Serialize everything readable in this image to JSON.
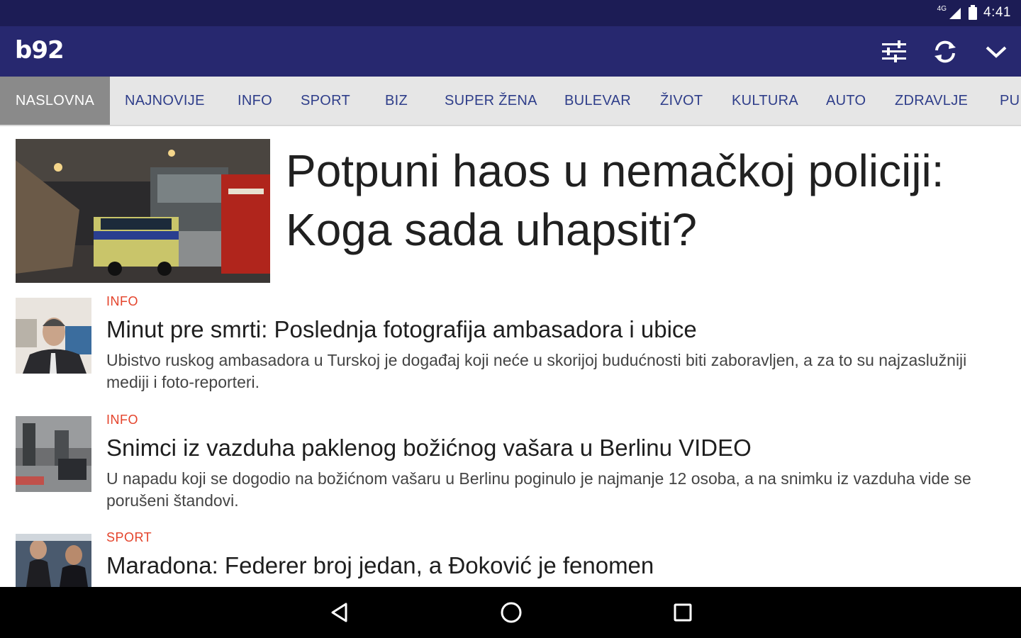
{
  "status_bar": {
    "network": "4G",
    "time": "4:41",
    "signal_icon": "signal-icon",
    "battery_icon": "battery-icon"
  },
  "app_bar": {
    "logo": "b92",
    "actions": [
      {
        "icon": "sliders-icon"
      },
      {
        "icon": "refresh-icon"
      },
      {
        "icon": "chevron-down-icon"
      }
    ]
  },
  "tabs": [
    {
      "label": "NASLOVNA",
      "active": true
    },
    {
      "label": "NAJNOVIJE"
    },
    {
      "label": "INFO"
    },
    {
      "label": "SPORT"
    },
    {
      "label": "BIZ"
    },
    {
      "label": "SUPER ŽENA"
    },
    {
      "label": "BULEVAR"
    },
    {
      "label": "ŽIVOT"
    },
    {
      "label": "KULTURA"
    },
    {
      "label": "AUTO"
    },
    {
      "label": "ZDRAVLJE"
    },
    {
      "label": "PU"
    }
  ],
  "featured": {
    "title": "Potpuni haos u nemačkoj policiji: Koga sada uhapsiti?"
  },
  "articles": [
    {
      "category": "INFO",
      "title": "Minut pre smrti: Poslednja fotografija ambasadora i ubice",
      "summary": "Ubistvo ruskog ambasadora u Turskoj je događaj koji neće u skorijoj budućnosti biti zaboravljen, a za to su najzaslužniji mediji i foto-reporteri."
    },
    {
      "category": "INFO",
      "title": "Snimci iz vazduha paklenog božićnog vašara u Berlinu VIDEO",
      "summary": "U napadu koji se dogodio na božićnom vašaru u Berlinu poginulo je najmanje 12 osoba, a na snimku iz vazduha vide se porušeni štandovi."
    },
    {
      "category": "SPORT",
      "title": "Maradona: Federer broj jedan, a Đoković je fenomen",
      "summary": ""
    }
  ],
  "nav_bar": {
    "buttons": [
      {
        "icon": "back-icon"
      },
      {
        "icon": "home-icon"
      },
      {
        "icon": "recents-icon"
      }
    ]
  },
  "colors": {
    "status_bar": "#1c1c55",
    "app_bar": "#27286f",
    "tab_text": "#2f3e8a",
    "tab_active_bg": "#8a8a8a",
    "category": "#e4432b"
  }
}
